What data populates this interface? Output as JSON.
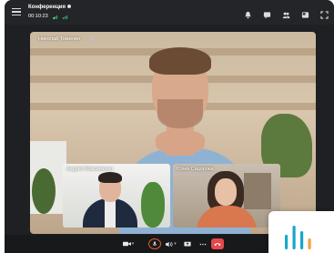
{
  "window": {
    "title": "Конференция",
    "timer": "00:10:23"
  },
  "main_video": {
    "participant_name": "Николай Томилин"
  },
  "tiles": [
    {
      "participant_name": "Андрей Максименко"
    },
    {
      "participant_name": "Юлия Сидорова"
    }
  ],
  "icons": {
    "menu": "menu-icon",
    "raise_hand": "bell-icon",
    "chat": "chat-icon",
    "participants": "participants-icon",
    "layout": "layout-icon",
    "fullscreen": "fullscreen-icon",
    "camera": "camera-icon",
    "microphone": "microphone-icon",
    "volume": "volume-icon",
    "screen_share": "screen-share-icon",
    "more": "more-icon",
    "end_call": "end-call-icon"
  },
  "colors": {
    "signal": "#38c172",
    "mic_ring": "#e55b2f",
    "end_call": "#e5484d",
    "logo_bar": "#1aa6c9"
  }
}
